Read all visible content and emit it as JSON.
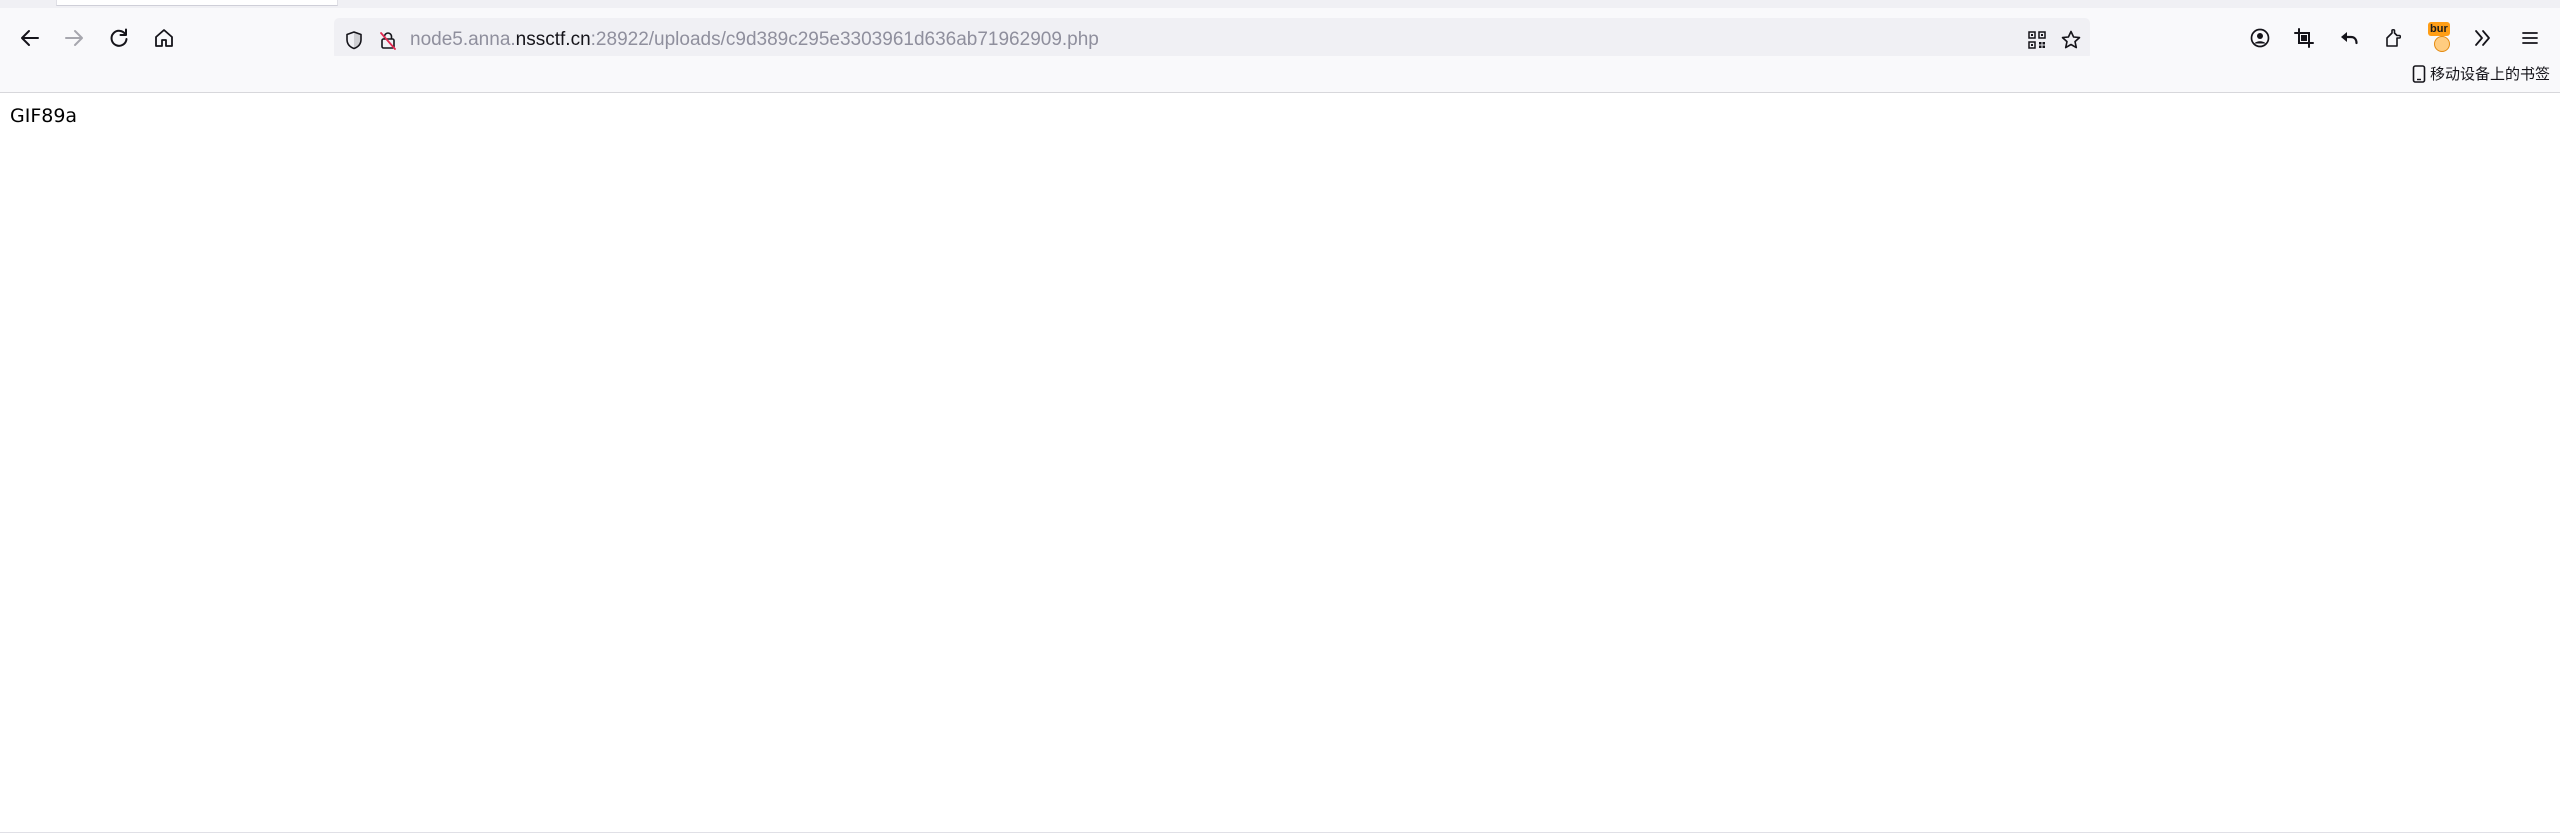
{
  "toolbar": {
    "url_host_prefix": "node5.anna.",
    "url_host_domain": "nssctf.cn",
    "url_path": ":28922/uploads/c9d389c295e3303961d636ab71962909.php",
    "burp_label": "bur"
  },
  "bookmarks_bar": {
    "mobile_bookmarks_label": "移动设备上的书签"
  },
  "page": {
    "body_text": "GIF89a"
  },
  "icons": {
    "back": "back-arrow-icon",
    "forward": "forward-arrow-icon",
    "reload": "reload-icon",
    "home": "home-icon",
    "tracking": "shield-icon",
    "insecure": "insecure-lock-icon",
    "qr": "qr-code-icon",
    "bookmark": "star-icon",
    "account": "account-icon",
    "screenshot": "crop-icon",
    "undo": "undo-arrow-icon",
    "extensions": "puzzle-icon",
    "overflow": "double-chevron-icon",
    "menu": "hamburger-menu-icon",
    "mobile": "mobile-device-icon"
  },
  "colors": {
    "toolbar_bg": "#f9f9fb",
    "urlbar_bg": "#f0f0f4",
    "icon": "#15141a",
    "url_dim": "#8f8f9d",
    "burp_orange": "#ff9e16"
  }
}
